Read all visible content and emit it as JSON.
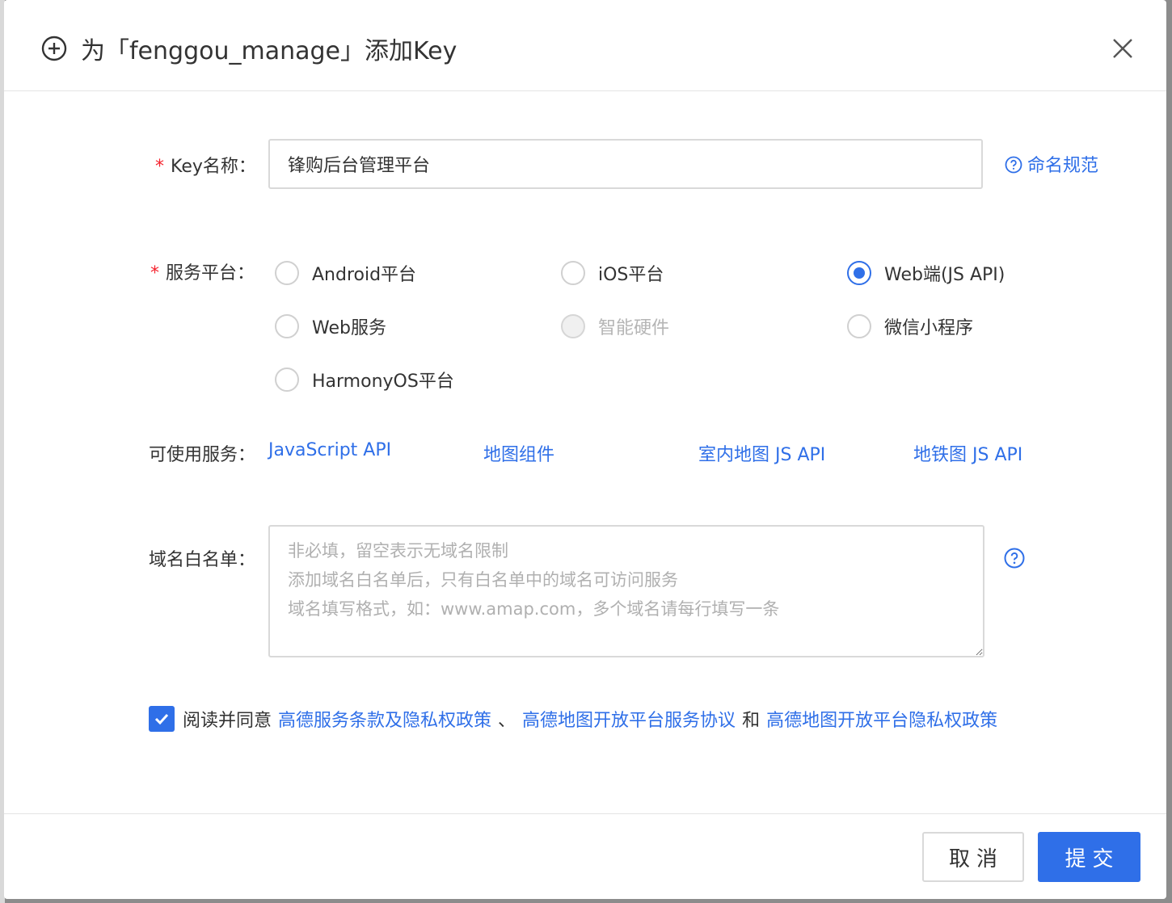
{
  "dialog": {
    "title": "为「fenggou_manage」添加Key",
    "icons": {
      "add": "circle-plus-icon",
      "close": "close-icon",
      "help": "question-circle-icon",
      "check": "checkmark-icon"
    }
  },
  "form": {
    "key_name": {
      "required_mark": "*",
      "label": "Key名称：",
      "value": "锋购后台管理平台",
      "hint_link": "命名规范"
    },
    "platform": {
      "required_mark": "*",
      "label": "服务平台：",
      "options": [
        {
          "label": "Android平台",
          "checked": false,
          "disabled": false
        },
        {
          "label": "iOS平台",
          "checked": false,
          "disabled": false
        },
        {
          "label": "Web端(JS API)",
          "checked": true,
          "disabled": false
        },
        {
          "label": "Web服务",
          "checked": false,
          "disabled": false
        },
        {
          "label": "智能硬件",
          "checked": false,
          "disabled": true
        },
        {
          "label": "微信小程序",
          "checked": false,
          "disabled": false
        },
        {
          "label": "HarmonyOS平台",
          "checked": false,
          "disabled": false
        }
      ]
    },
    "services": {
      "label": "可使用服务：",
      "links": [
        "JavaScript API",
        "地图组件",
        "室内地图 JS API",
        "地铁图 JS API"
      ]
    },
    "whitelist": {
      "label": "域名白名单：",
      "placeholder": "非必填，留空表示无域名限制\n添加域名白名单后，只有白名单中的域名可访问服务\n域名填写格式，如：www.amap.com，多个域名请每行填写一条",
      "value": ""
    },
    "agreement": {
      "checked": true,
      "prefix": "阅读并同意",
      "link1": "高德服务条款及隐私权政策",
      "sep1": "、",
      "link2": "高德地图开放平台服务协议",
      "sep2": "和",
      "link3": "高德地图开放平台隐私权政策"
    }
  },
  "footer": {
    "cancel_label": "取消",
    "submit_label": "提交"
  },
  "colors": {
    "primary": "#2f6fe8",
    "required": "#f5222d",
    "border": "#d9d9d9",
    "disabled_text": "#b5b5b5"
  }
}
